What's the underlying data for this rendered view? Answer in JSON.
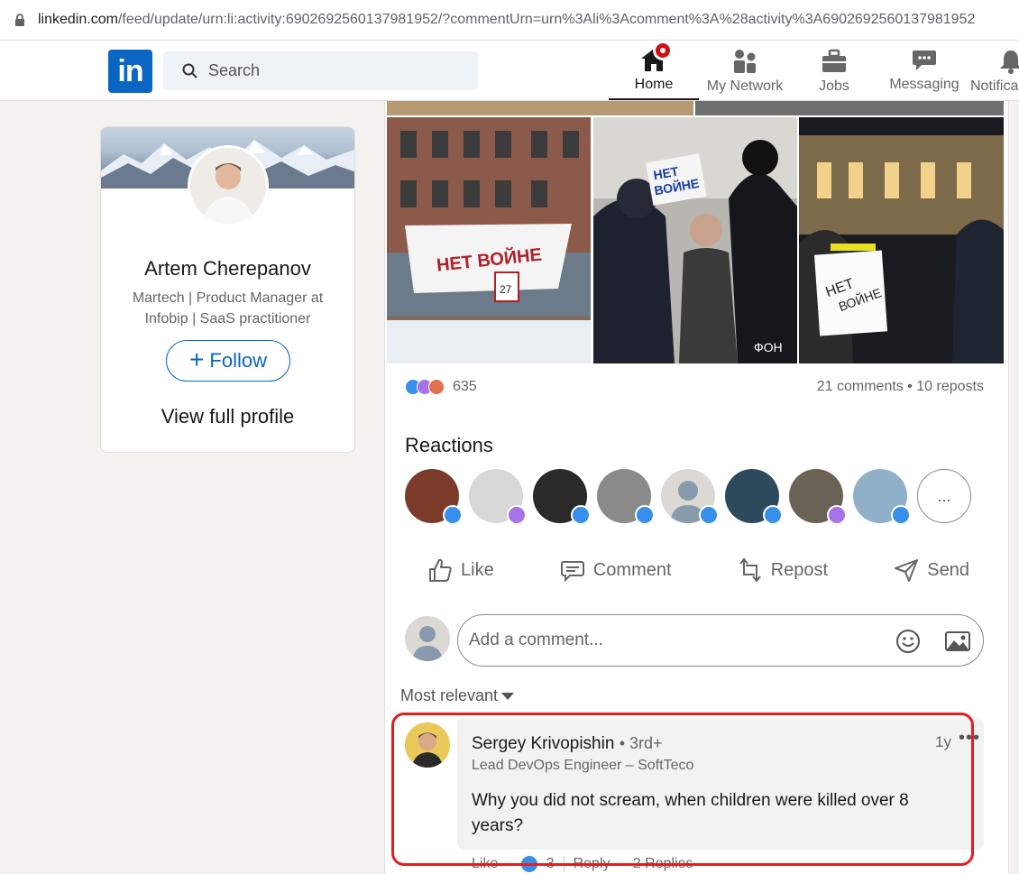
{
  "browser": {
    "url_host": "linkedin.com",
    "url_path": "/feed/update/urn:li:activity:6902692560137981952/?commentUrn=urn%3Ali%3Acomment%3A%28activity%3A6902692560137981952"
  },
  "nav": {
    "logo": "in",
    "search_placeholder": "Search",
    "items": [
      {
        "label": "Home"
      },
      {
        "label": "My Network"
      },
      {
        "label": "Jobs"
      },
      {
        "label": "Messaging"
      },
      {
        "label": "Notifica"
      }
    ]
  },
  "profile": {
    "name": "Artem Cherepanov",
    "headline": "Martech | Product Manager at Infobip | SaaS practitioner",
    "follow_label": "Follow",
    "view_full_label": "View full profile"
  },
  "post": {
    "reaction_count": "635",
    "stats": "21 comments • 10 reposts",
    "reactions_title": "Reactions",
    "more_reactors": "...",
    "actions": [
      {
        "label": "Like"
      },
      {
        "label": "Comment"
      },
      {
        "label": "Repost"
      },
      {
        "label": "Send"
      }
    ],
    "comment_placeholder": "Add a comment...",
    "sort_label": "Most relevant"
  },
  "comment": {
    "author": "Sergey Krivopishin",
    "degree": "• 3rd+",
    "time": "1y",
    "more": "•••",
    "headline": "Lead DevOps Engineer – SoftTeco",
    "text": "Why you did not scream, when children were killed over 8 years?",
    "footer_like": "Like",
    "footer_like_dot": "·",
    "footer_count": "3",
    "footer_reply": "Reply",
    "footer_reply_dot": "·",
    "footer_replies": "2 Replies"
  },
  "colors": {
    "brand": "#0a66c2",
    "highlight": "#e02020",
    "notification": "#cc1016"
  }
}
